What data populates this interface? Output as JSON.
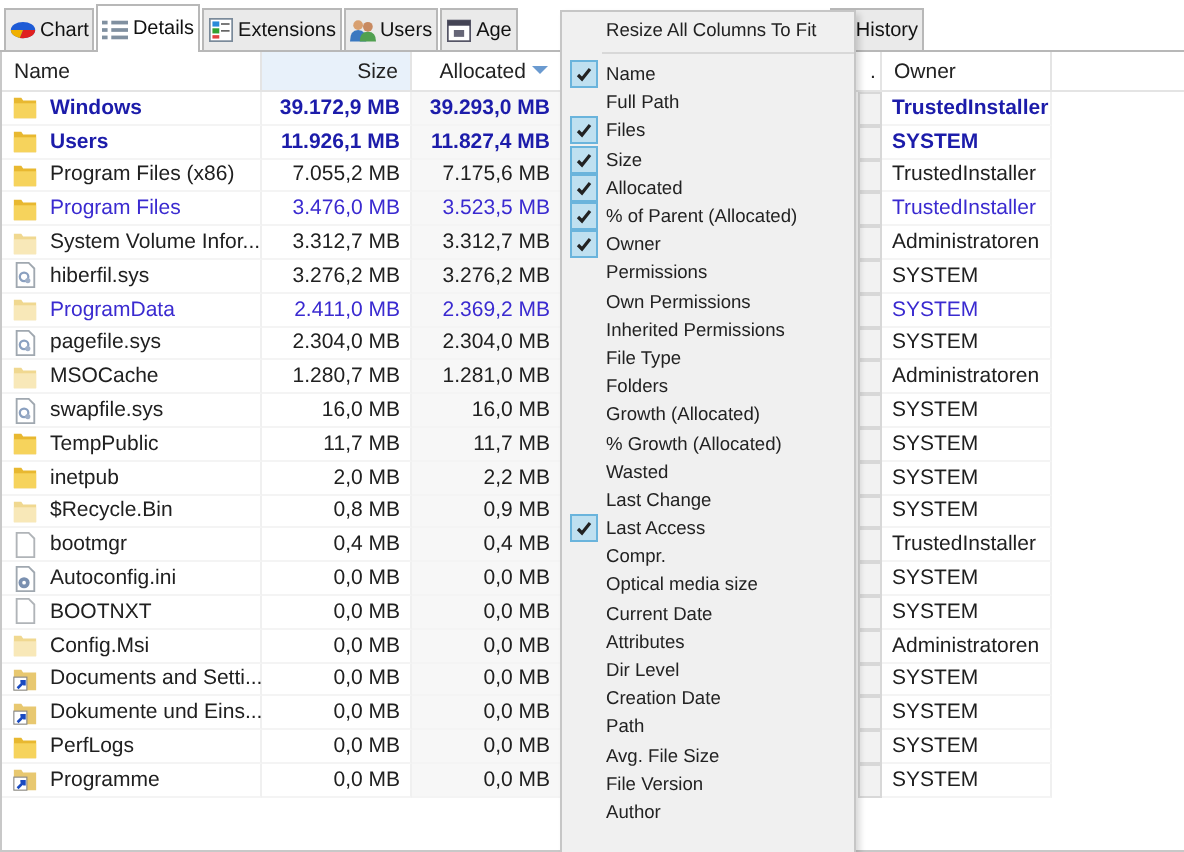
{
  "tabs": [
    {
      "label": "Chart",
      "kind": "chart",
      "selected": false
    },
    {
      "label": "Details",
      "kind": "details",
      "selected": true
    },
    {
      "label": "Extensions",
      "kind": "extensions",
      "selected": false
    },
    {
      "label": "Users",
      "kind": "users",
      "selected": false
    },
    {
      "label": "Age",
      "kind": "age",
      "selected": false
    },
    {
      "label": "History",
      "kind": "history",
      "selected": false
    }
  ],
  "table": {
    "columns": [
      {
        "label": "Name",
        "sorted": false
      },
      {
        "label": "Size",
        "sorted": false
      },
      {
        "label": "Allocated",
        "sorted": true
      },
      {
        "label": ".",
        "sorted": false
      },
      {
        "label": "Owner",
        "sorted": false
      }
    ],
    "rows": [
      {
        "kind": "folder",
        "name": "Windows",
        "size": "39.172,9 MB",
        "allocated": "39.293,0 MB",
        "owner": "TrustedInstaller",
        "color": "#1c1caa",
        "bold": true
      },
      {
        "kind": "folder",
        "name": "Users",
        "size": "11.926,1 MB",
        "allocated": "11.827,4 MB",
        "owner": "SYSTEM",
        "color": "#1c1caa",
        "bold": true
      },
      {
        "kind": "folder",
        "name": "Program Files (x86)",
        "size": "7.055,2 MB",
        "allocated": "7.175,6 MB",
        "owner": "TrustedInstaller",
        "color": "#202020",
        "bold": false
      },
      {
        "kind": "folder",
        "name": "Program Files",
        "size": "3.476,0 MB",
        "allocated": "3.523,5 MB",
        "owner": "TrustedInstaller",
        "color": "#3a2ad0",
        "bold": false
      },
      {
        "kind": "folder-pale",
        "name": "System Volume Infor...",
        "size": "3.312,7 MB",
        "allocated": "3.312,7 MB",
        "owner": "Administratoren",
        "color": "#202020",
        "bold": false
      },
      {
        "kind": "system-file",
        "name": "hiberfil.sys",
        "size": "3.276,2 MB",
        "allocated": "3.276,2 MB",
        "owner": "SYSTEM",
        "color": "#202020",
        "bold": false
      },
      {
        "kind": "folder-pale",
        "name": "ProgramData",
        "size": "2.411,0 MB",
        "allocated": "2.369,2 MB",
        "owner": "SYSTEM",
        "color": "#3a2ad0",
        "bold": false
      },
      {
        "kind": "system-file",
        "name": "pagefile.sys",
        "size": "2.304,0 MB",
        "allocated": "2.304,0 MB",
        "owner": "SYSTEM",
        "color": "#202020",
        "bold": false
      },
      {
        "kind": "folder-pale",
        "name": "MSOCache",
        "size": "1.280,7 MB",
        "allocated": "1.281,0 MB",
        "owner": "Administratoren",
        "color": "#202020",
        "bold": false
      },
      {
        "kind": "system-file",
        "name": "swapfile.sys",
        "size": "16,0 MB",
        "allocated": "16,0 MB",
        "owner": "SYSTEM",
        "color": "#202020",
        "bold": false
      },
      {
        "kind": "folder",
        "name": "TempPublic",
        "size": "11,7 MB",
        "allocated": "11,7 MB",
        "owner": "SYSTEM",
        "color": "#202020",
        "bold": false
      },
      {
        "kind": "folder",
        "name": "inetpub",
        "size": "2,0 MB",
        "allocated": "2,2 MB",
        "owner": "SYSTEM",
        "color": "#202020",
        "bold": false
      },
      {
        "kind": "folder-pale",
        "name": "$Recycle.Bin",
        "size": "0,8 MB",
        "allocated": "0,9 MB",
        "owner": "SYSTEM",
        "color": "#202020",
        "bold": false
      },
      {
        "kind": "file",
        "name": "bootmgr",
        "size": "0,4 MB",
        "allocated": "0,4 MB",
        "owner": "TrustedInstaller",
        "color": "#202020",
        "bold": false
      },
      {
        "kind": "settings-file",
        "name": "Autoconfig.ini",
        "size": "0,0 MB",
        "allocated": "0,0 MB",
        "owner": "SYSTEM",
        "color": "#202020",
        "bold": false
      },
      {
        "kind": "file",
        "name": "BOOTNXT",
        "size": "0,0 MB",
        "allocated": "0,0 MB",
        "owner": "SYSTEM",
        "color": "#202020",
        "bold": false
      },
      {
        "kind": "folder-pale",
        "name": "Config.Msi",
        "size": "0,0 MB",
        "allocated": "0,0 MB",
        "owner": "Administratoren",
        "color": "#202020",
        "bold": false
      },
      {
        "kind": "shortcut",
        "name": "Documents and Setti...",
        "size": "0,0 MB",
        "allocated": "0,0 MB",
        "owner": "SYSTEM",
        "color": "#202020",
        "bold": false
      },
      {
        "kind": "shortcut",
        "name": "Dokumente und Eins...",
        "size": "0,0 MB",
        "allocated": "0,0 MB",
        "owner": "SYSTEM",
        "color": "#202020",
        "bold": false
      },
      {
        "kind": "folder",
        "name": "PerfLogs",
        "size": "0,0 MB",
        "allocated": "0,0 MB",
        "owner": "SYSTEM",
        "color": "#202020",
        "bold": false
      },
      {
        "kind": "shortcut",
        "name": "Programme",
        "size": "0,0 MB",
        "allocated": "0,0 MB",
        "owner": "SYSTEM",
        "color": "#202020",
        "bold": false
      }
    ]
  },
  "context_menu": {
    "header": "Resize All Columns To Fit",
    "items": [
      {
        "label": "Name",
        "checked": true
      },
      {
        "label": "Full Path",
        "checked": false
      },
      {
        "label": "Files",
        "checked": true
      },
      {
        "label": "Size",
        "checked": true
      },
      {
        "label": "Allocated",
        "checked": true
      },
      {
        "label": "% of Parent (Allocated)",
        "checked": true
      },
      {
        "label": "Owner",
        "checked": true
      },
      {
        "label": "Permissions",
        "checked": false
      },
      {
        "label": "Own Permissions",
        "checked": false
      },
      {
        "label": "Inherited Permissions",
        "checked": false
      },
      {
        "label": "File Type",
        "checked": false
      },
      {
        "label": "Folders",
        "checked": false
      },
      {
        "label": "Growth (Allocated)",
        "checked": false
      },
      {
        "label": "% Growth (Allocated)",
        "checked": false
      },
      {
        "label": "Wasted",
        "checked": false
      },
      {
        "label": "Last Change",
        "checked": false
      },
      {
        "label": "Last Access",
        "checked": true
      },
      {
        "label": "Compr.",
        "checked": false
      },
      {
        "label": "Optical media size",
        "checked": false
      },
      {
        "label": "Current Date",
        "checked": false
      },
      {
        "label": "Attributes",
        "checked": false
      },
      {
        "label": "Dir Level",
        "checked": false
      },
      {
        "label": "Creation Date",
        "checked": false
      },
      {
        "label": "Path",
        "checked": false
      },
      {
        "label": "Avg. File Size",
        "checked": false
      },
      {
        "label": "File Version",
        "checked": false
      },
      {
        "label": "Author",
        "checked": false
      }
    ]
  }
}
